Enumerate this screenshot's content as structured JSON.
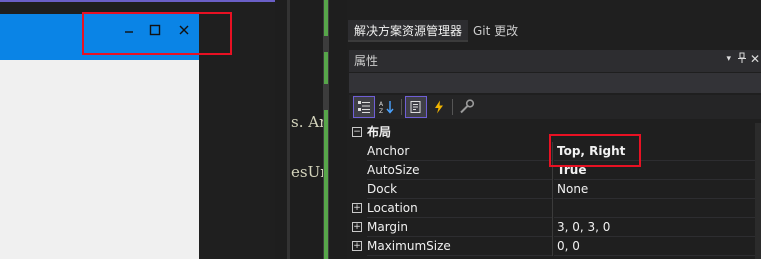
{
  "form_window": {
    "minimize_glyph": "–",
    "maximize_glyph": "□",
    "close_glyph": "✕"
  },
  "code_editor": {
    "lines": [
      "s. Ar",
      "esUr"
    ]
  },
  "tabs": [
    {
      "label": "解决方案资源管理器"
    },
    {
      "label": "Git 更改"
    }
  ],
  "properties": {
    "title": "属性",
    "dropdown_glyph": "▾",
    "pin_glyph": "📌",
    "close_glyph": "✕",
    "toolbar": {
      "categorized": "categorized-icon",
      "alphabetical": "alphabetical-icon",
      "properties": "properties-icon",
      "events": "events-icon",
      "property_pages": "property-pages-icon"
    },
    "category": {
      "expander": "⊟",
      "label": "布局"
    },
    "rows": [
      {
        "name": "Anchor",
        "value": "Top, Right",
        "bold": true
      },
      {
        "name": "AutoSize",
        "value": "True",
        "bold": true
      },
      {
        "name": "Dock",
        "value": "None",
        "bold": false
      },
      {
        "name": "Location",
        "value": "",
        "bold": false,
        "expander": "+"
      },
      {
        "name": "Margin",
        "value": "3, 0, 3, 0",
        "bold": false,
        "expander": "+"
      },
      {
        "name": "MaximumSize",
        "value": "0, 0",
        "bold": false,
        "expander": "+"
      }
    ]
  },
  "colors": {
    "form_titlebar": "#0a84e6",
    "highlight_box": "#e81123",
    "accent": "#6a5fc7",
    "code_change_marker": "#57a64a"
  }
}
